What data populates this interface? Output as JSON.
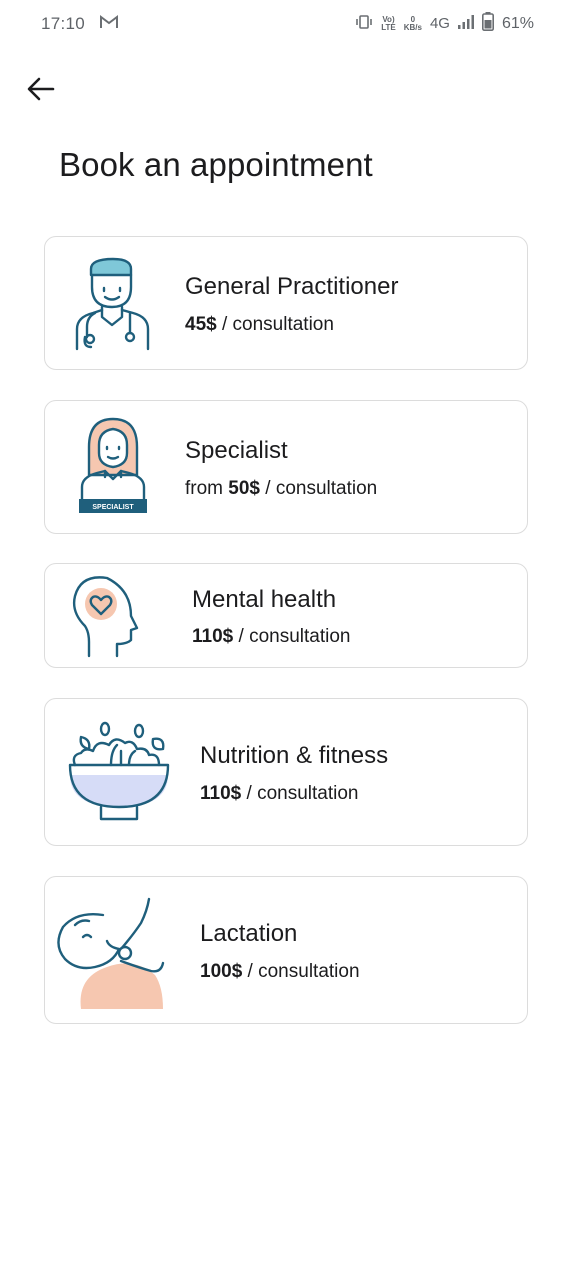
{
  "status_bar": {
    "time": "17:10",
    "network_top": "Vo)",
    "network_bottom": "LTE",
    "speed_value": "0",
    "speed_unit": "KB/s",
    "network_type": "4G",
    "battery": "61%"
  },
  "header": {
    "title": "Book an appointment"
  },
  "cards": [
    {
      "title": "General Practitioner",
      "prefix": "",
      "amount": "45$",
      "suffix": " / consultation"
    },
    {
      "title": "Specialist",
      "prefix": "from ",
      "amount": "50$",
      "suffix": " / consultation",
      "badge": "SPECIALIST"
    },
    {
      "title": "Mental health",
      "prefix": "",
      "amount": "110$",
      "suffix": " / consultation"
    },
    {
      "title": "Nutrition & fitness",
      "prefix": "",
      "amount": "110$",
      "suffix": " / consultation"
    },
    {
      "title": "Lactation",
      "prefix": "",
      "amount": "100$",
      "suffix": " / consultation"
    }
  ],
  "colors": {
    "icon_stroke": "#1f5f7c",
    "accent_skin": "#f6c7b0",
    "accent_hair": "#7fc8d8",
    "bowl_fill": "#d6dcf7"
  }
}
